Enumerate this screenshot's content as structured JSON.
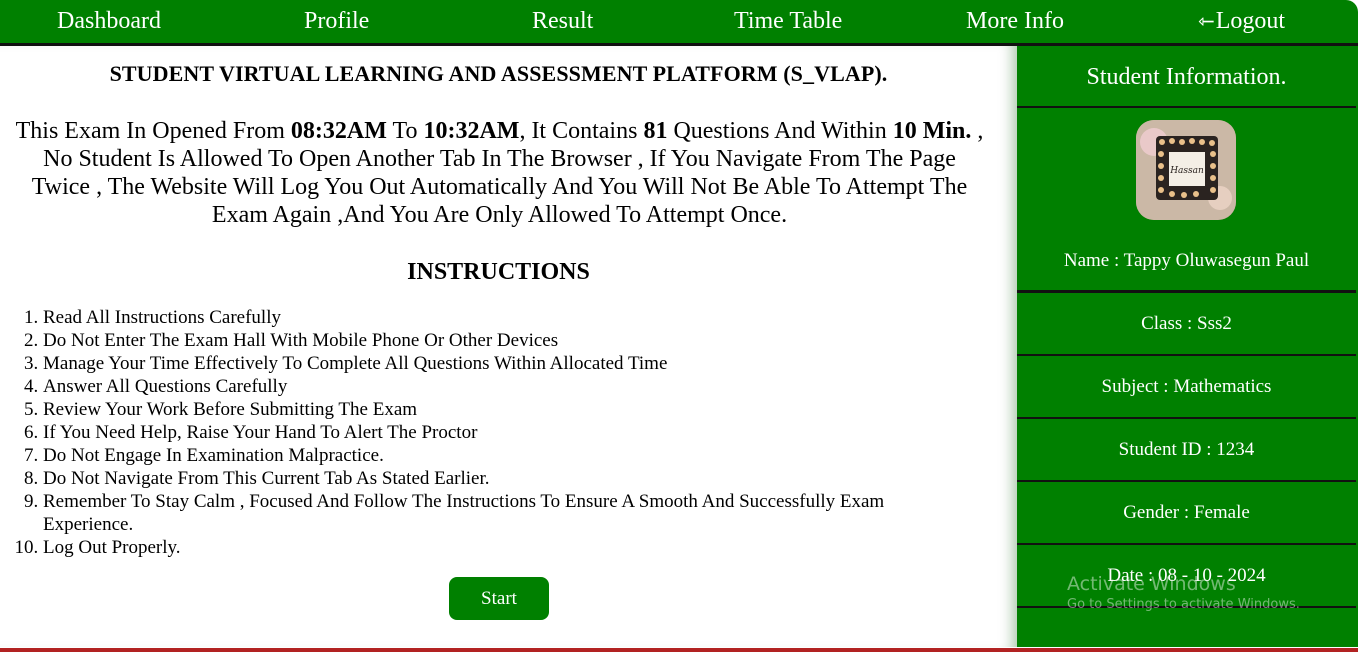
{
  "nav": {
    "dashboard": "Dashboard",
    "profile": "Profile",
    "result": "Result",
    "timetable": "Time Table",
    "moreinfo": "More Info",
    "logout": "Logout",
    "logout_icon": "logout-icon"
  },
  "main": {
    "platform_title": "STUDENT VIRTUAL LEARNING AND ASSESSMENT PLATFORM (S_VLAP).",
    "notice": {
      "p1": "This Exam In Opened From ",
      "open_time": "08:32AM",
      "p2": " To ",
      "close_time": "10:32AM",
      "p3": ", It Contains ",
      "question_count": "81",
      "p4": " Questions And Within ",
      "duration": "10 Min.",
      "p5": " , No Student Is Allowed To Open Another Tab In The Browser , If You Navigate From The Page Twice , The Website Will Log You Out Automatically And You Will Not Be Able To Attempt The Exam Again ,And You Are Only Allowed To Attempt Once."
    },
    "instructions_title": "INSTRUCTIONS",
    "instructions": [
      "Read All Instructions Carefully",
      "Do Not Enter The Exam Hall With Mobile Phone Or Other Devices",
      "Manage Your Time Effectively To Complete All Questions Within Allocated Time",
      "Answer All Questions Carefully",
      "Review Your Work Before Submitting The Exam",
      "If You Need Help, Raise Your Hand To Alert The Proctor",
      "Do Not Engage In Examination Malpractice.",
      "Do Not Navigate From This Current Tab As Stated Earlier.",
      "Remember To Stay Calm , Focused And Follow The Instructions To Ensure A Smooth And Successfully Exam Experience.",
      "Log Out Properly."
    ],
    "start_label": "Start"
  },
  "sidebar": {
    "title": "Student Information.",
    "avatar_text": "Hassan",
    "name": "Name : Tappy Oluwasegun Paul",
    "class": "Class : Sss2",
    "subject": "Subject : Mathematics",
    "student_id": "Student ID : 1234",
    "gender": "Gender : Female",
    "date": "Date : 08 - 10 - 2024"
  },
  "watermark": {
    "title": "Activate Windows",
    "subtitle": "Go to Settings to activate Windows."
  },
  "colors": {
    "brand_green": "#008000",
    "border_red": "#b22222",
    "divider": "#111111"
  }
}
